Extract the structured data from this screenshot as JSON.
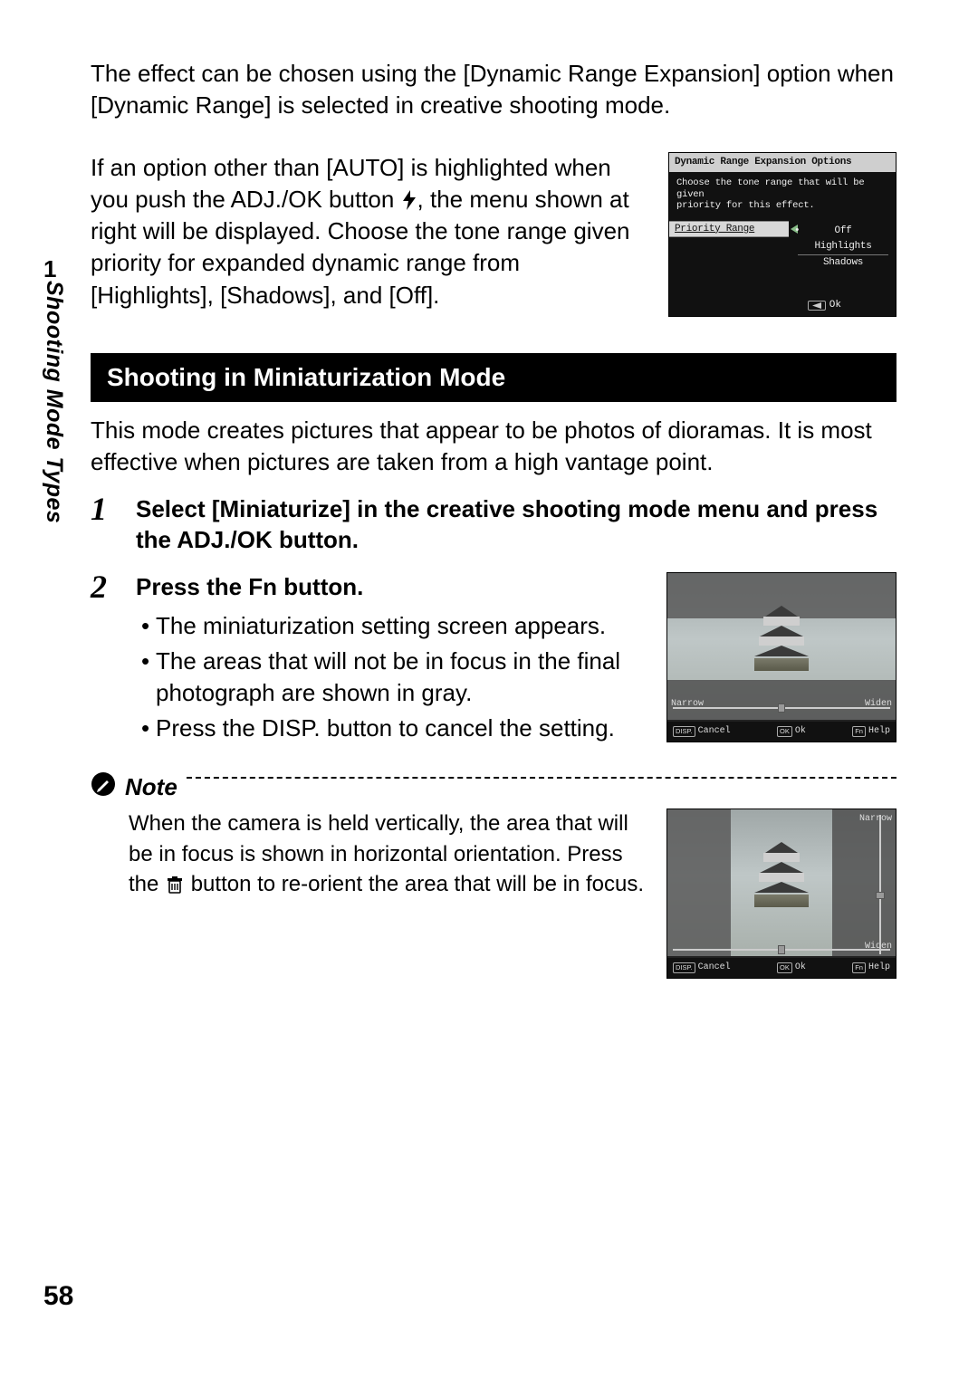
{
  "margin": {
    "chapter_num": "1",
    "side_label": "Shooting Mode Types",
    "page_num": "58"
  },
  "intro1": "The effect can be chosen using the [Dynamic Range Expansion] option when [Dynamic Range] is selected in creative shooting mode.",
  "intro2a": "If an option other than [AUTO] is highlighted when you push the ADJ./OK button ",
  "intro2b": ", the menu shown at right will be displayed. Choose the tone range given priority for expanded dynamic range from [Highlights], [Shadows], and [Off].",
  "dr_screen": {
    "title": "Dynamic Range Expansion Options",
    "desc1": "Choose the tone range that will be given",
    "desc2": "priority for this effect.",
    "label": "Priority Range",
    "opt_off": "Off",
    "opt_hi": "Highlights",
    "opt_sh": "Shadows",
    "ok": "Ok"
  },
  "section_heading": "Shooting in Miniaturization Mode",
  "section_intro": "This mode creates pictures that appear to be photos of dioramas. It is most effective when pictures are taken from a high vantage point.",
  "step1": {
    "num": "1",
    "title": "Select [Miniaturize] in the creative shooting mode menu and press the ADJ./OK button."
  },
  "step2": {
    "num": "2",
    "title": "Press the Fn button.",
    "b1": "The miniaturization setting screen appears.",
    "b2": "The areas that will not be in focus in the final photograph are shown in gray.",
    "b3": "Press the DISP. button to cancel the setting."
  },
  "cam": {
    "narrow": "Narrow",
    "widen": "Widen",
    "disp": "DISP.",
    "cancel": "Cancel",
    "ok_key": "OK",
    "ok": "Ok",
    "fn": "Fn",
    "help": "Help"
  },
  "note": {
    "heading": "Note",
    "text_a": "When the camera is held vertically, the area that will be in focus is shown in horizontal orientation. Press the ",
    "text_b": " button to re-orient the area that will be in focus."
  }
}
